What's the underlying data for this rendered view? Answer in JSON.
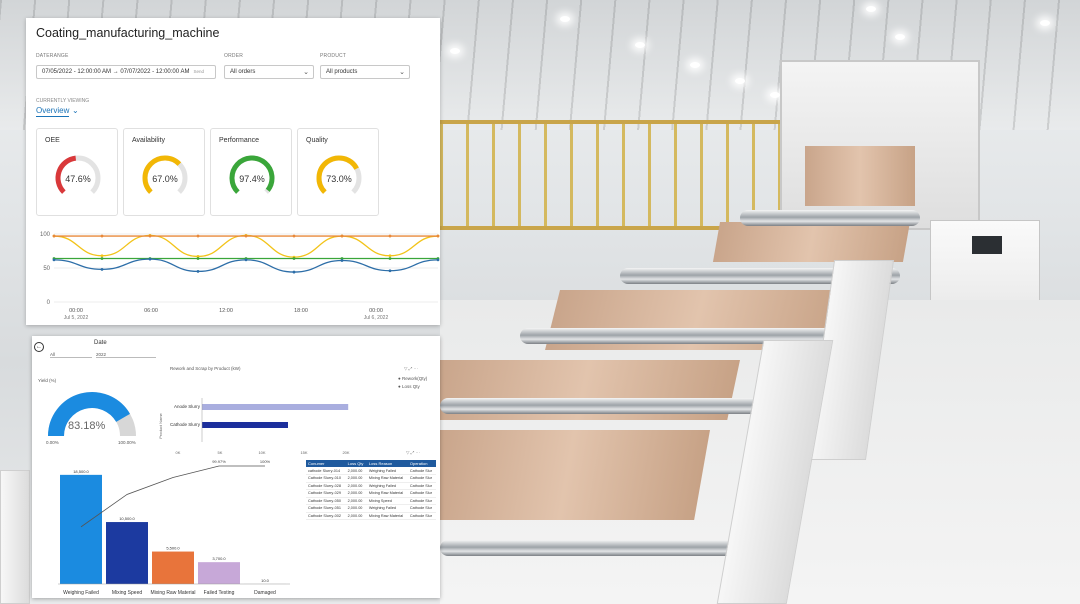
{
  "dashboard": {
    "title": "Coating_manufacturing_machine",
    "filters": {
      "daterange_label": "DATERANGE",
      "daterange_value": "07/05/2022 - 12:00:00 AM → 07/07/2022 - 12:00:00 AM",
      "clear_label": "Send",
      "order_label": "ORDER",
      "order_value": "All orders",
      "product_label": "PRODUCT",
      "product_value": "All products"
    },
    "currently_viewing_label": "CURRENTLY VIEWING",
    "view_value": "Overview",
    "kpis": [
      {
        "label": "OEE",
        "value": "47.6%",
        "fraction": 0.476,
        "color": "#d9383a"
      },
      {
        "label": "Availability",
        "value": "67.0%",
        "fraction": 0.67,
        "color": "#f2b705"
      },
      {
        "label": "Performance",
        "value": "97.4%",
        "fraction": 0.974,
        "color": "#3aa63a"
      },
      {
        "label": "Quality",
        "value": "73.0%",
        "fraction": 0.73,
        "color": "#f2b705"
      }
    ],
    "trend": {
      "y_ticks": [
        "100",
        "50",
        "0"
      ],
      "x_ticks": [
        "00:00",
        "06:00",
        "12:00",
        "18:00",
        "00:00"
      ],
      "x_subs": [
        "Jul 5, 2022",
        "",
        "",
        "",
        "Jul 6, 2022"
      ]
    }
  },
  "report": {
    "date_label": "Date",
    "slicer_all": "All",
    "slicer_year": "2022",
    "yield_label": "Yield (%)",
    "yield_value": "83.18%",
    "yield_fraction": 0.8318,
    "yield_min": "0.00%",
    "yield_max": "100.00%",
    "rework_title": "Rework and Scrap by Product (kW)",
    "legend": [
      "Rework(Qty)",
      "Loss Qty"
    ],
    "products": [
      "Anode Slurry",
      "Cathode Slurry"
    ],
    "product_axis_label": "Product Name",
    "bar_axis": [
      "0K",
      "5K",
      "10K",
      "15K",
      "20K"
    ],
    "table": {
      "headers": [
        "Conumer",
        "Loss Qty",
        "Loss Reason",
        "Operation"
      ],
      "rows": [
        [
          "cathode Slurry-014",
          "2,000.00",
          "Weighing Failed",
          "Cathode Slur"
        ],
        [
          "Cathode Slurry-010",
          "2,000.00",
          "Mixing Raw Material",
          "Cathode Slur"
        ],
        [
          "Cathode Slurry-028",
          "2,000.00",
          "Weighing Failed",
          "Cathode Slur"
        ],
        [
          "Cathode Slurry-029",
          "2,000.00",
          "Mixing Raw Material",
          "Cathode Slur"
        ],
        [
          "Cathode Slurry-050",
          "2,000.00",
          "Mixing Speed",
          "Cathode Slur"
        ],
        [
          "Cathode Slurry-051",
          "2,000.00",
          "Weighing Failed",
          "Cathode Slur"
        ],
        [
          "Cathode Slurry-002",
          "2,000.00",
          "Mixing Raw Material",
          "Cathode Slur"
        ]
      ]
    }
  },
  "chart_data": [
    {
      "type": "line",
      "title": "",
      "x": [
        "00:00",
        "06:00",
        "12:00",
        "18:00",
        "00:00"
      ],
      "ylim": [
        0,
        100
      ],
      "series": [
        {
          "color": "#f2c319",
          "values": [
            97,
            68,
            98,
            67,
            98,
            66,
            97,
            68,
            97
          ]
        },
        {
          "color": "#3aa63a",
          "values": [
            64,
            64,
            64,
            64,
            64,
            64,
            64,
            64,
            64
          ]
        },
        {
          "color": "#2d6ea8",
          "values": [
            62,
            48,
            63,
            45,
            62,
            44,
            61,
            46,
            62
          ]
        },
        {
          "color": "#e8893a",
          "values": [
            97,
            97,
            97,
            97,
            97,
            97,
            97,
            97,
            97
          ]
        }
      ]
    },
    {
      "type": "bar",
      "title": "Rework and Scrap by Product (kW)",
      "categories": [
        "Anode Slurry",
        "Cathode Slurry"
      ],
      "series": [
        {
          "name": "Rework(Qty)",
          "color": "#a9aedf",
          "values": [
            17000,
            0
          ]
        },
        {
          "name": "Loss Qty",
          "color": "#1c2f9c",
          "values": [
            0,
            10000
          ]
        }
      ],
      "xlim": [
        0,
        20000
      ]
    },
    {
      "type": "bar",
      "title": "",
      "categories": [
        "Weighing Failed",
        "Mixing Speed",
        "Mixing Raw Material",
        "Failed Testing",
        "Damaged"
      ],
      "values": [
        18500,
        10500,
        5500,
        3700,
        10
      ],
      "value_labels": [
        "18,500.0",
        "10,500.0",
        "5,500.0",
        "3,700.0",
        "10.0"
      ],
      "colors": [
        "#1b8be0",
        "#1c3aa0",
        "#e8743b",
        "#c7a8d8",
        "#cccccc"
      ],
      "cumulative_pct": [
        48.4,
        75.9,
        90.3,
        99.97,
        100
      ],
      "cumulative_labels": [
        "",
        "",
        "",
        "99.97%",
        "100%"
      ]
    }
  ]
}
